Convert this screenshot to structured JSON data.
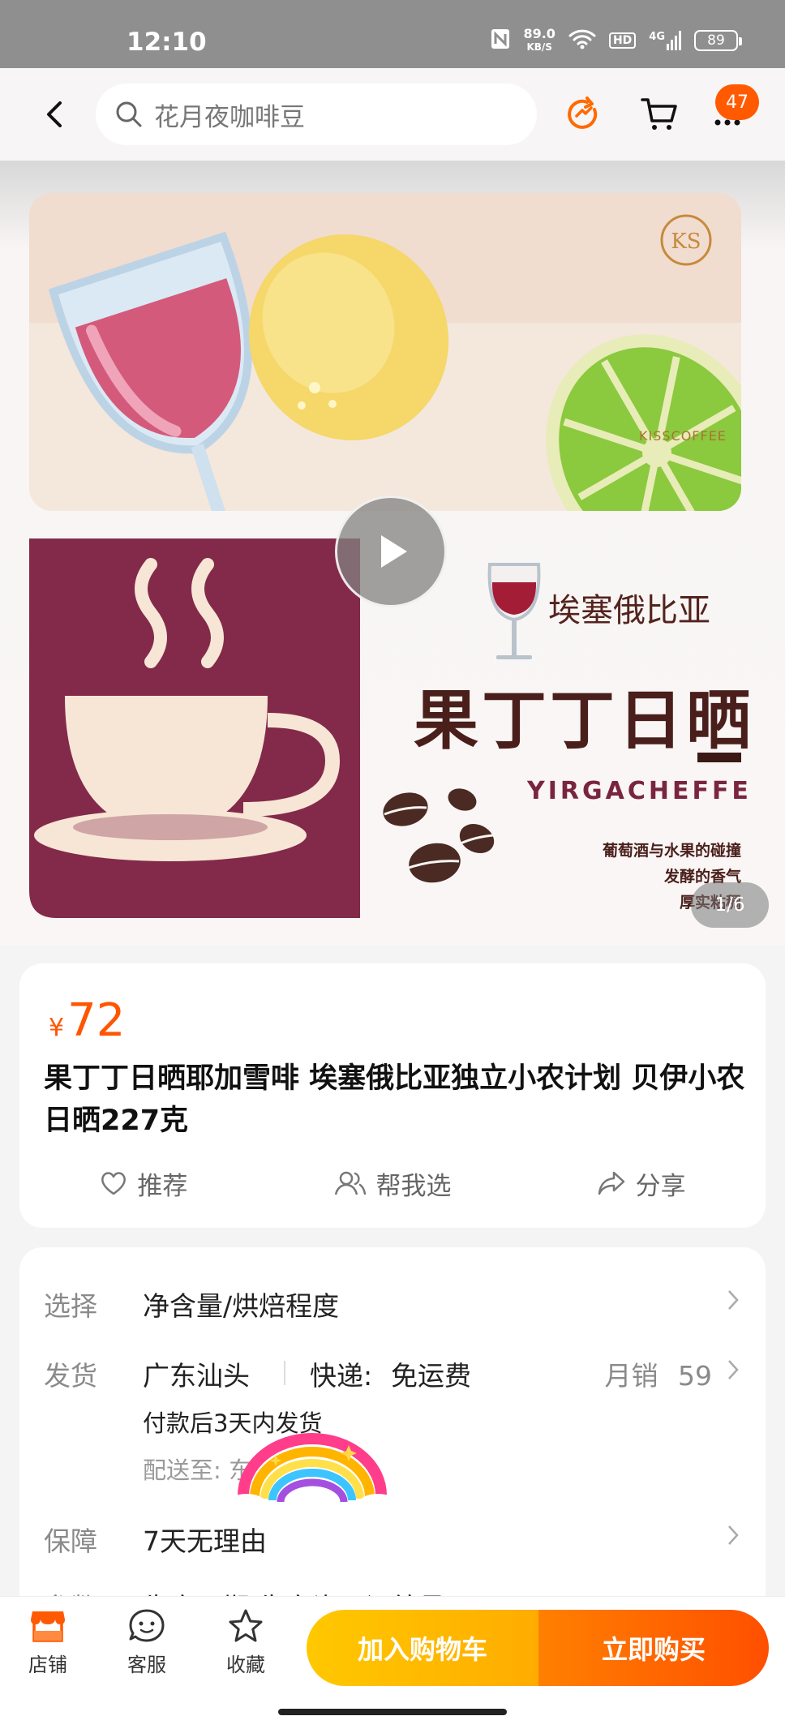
{
  "status_bar": {
    "time": "12:10",
    "network_speed": "89.0",
    "speed_unit": "KB/S",
    "hd": "HD",
    "signal": "4G",
    "battery": "89"
  },
  "header": {
    "search_placeholder": "花月夜咖啡豆",
    "cart_badge": "47"
  },
  "hero": {
    "brand": "KISSCOFFEE",
    "logo_letters": "KS",
    "region": "埃塞俄比亚",
    "product_name": "果丁丁日晒",
    "latin_name": "YIRGACHEFFE",
    "notes": [
      "葡萄酒与水果的碰撞",
      "发酵的香气",
      "厚实粘稠"
    ],
    "counter": "1/6"
  },
  "product": {
    "currency": "¥",
    "price": "72",
    "title": "果丁丁日晒耶加雪啡 埃塞俄比亚独立小农计划 贝伊小农日晒227克",
    "actions": [
      "推荐",
      "帮我选",
      "分享"
    ]
  },
  "details": {
    "select_label": "选择",
    "select_value": "净含量/烘焙程度",
    "ship_label": "发货",
    "ship_origin": "广东汕头",
    "ship_method": "快递:",
    "ship_fee": "免运费",
    "monthly_sales": "月销",
    "monthly_sales_count": "59",
    "ship_time": "付款后3天内发货",
    "deliver_to": "配送至: 东",
    "guarantee_label": "保障",
    "guarantee_value": "7天无理由",
    "params_label": "参数",
    "params_value": "生产日期 生产许可证编号"
  },
  "bottom_bar": {
    "store": "店铺",
    "service": "客服",
    "favorite": "收藏",
    "add_to_cart": "加入购物车",
    "buy_now": "立即购买"
  },
  "colors": {
    "accent": "#ff5500",
    "cart_button": "#ffb800",
    "buy_button": "#ff5a00",
    "wine": "#8a2444"
  }
}
